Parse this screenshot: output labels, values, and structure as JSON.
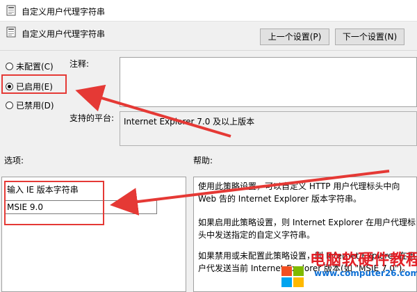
{
  "window": {
    "title": "自定义用户代理字符串"
  },
  "header": {
    "title": "自定义用户代理字符串",
    "prev_label": "上一个设置(P)",
    "next_label": "下一个设置(N)"
  },
  "state": {
    "not_configured": "未配置(C)",
    "enabled": "已启用(E)",
    "disabled": "已禁用(D)",
    "selected": "enabled"
  },
  "comment": {
    "label": "注释:",
    "value": ""
  },
  "platform": {
    "label": "支持的平台:",
    "value": "Internet Explorer 7.0 及以上版本"
  },
  "options": {
    "label": "选项:",
    "field_label": "输入 IE 版本字符串",
    "field_value": "MSIE 9.0"
  },
  "help": {
    "label": "帮助:",
    "paragraphs": [
      "使用此策略设置，可以自定义 HTTP 用户代理标头中向 Web 告的 Internet Explorer 版本字符串。",
      "如果启用此策略设置，则 Internet Explorer 在用户代理标头中发送指定的自定义字符串。",
      "如果禁用或未配置此策略设置，则 Internet Explorer 在用户代发送当前 Internet Explorer 版本(如 \"MSIE 7.0\")。"
    ]
  },
  "watermark": {
    "text": "电脑软硬件教程网",
    "url": "www.computer26.com"
  },
  "colors": {
    "annotation_red": "#e53935",
    "watermark_red": "#e21f26",
    "watermark_blue": "#0d6fd4"
  },
  "icons": {
    "window": "policy-icon",
    "header": "policy-icon"
  }
}
